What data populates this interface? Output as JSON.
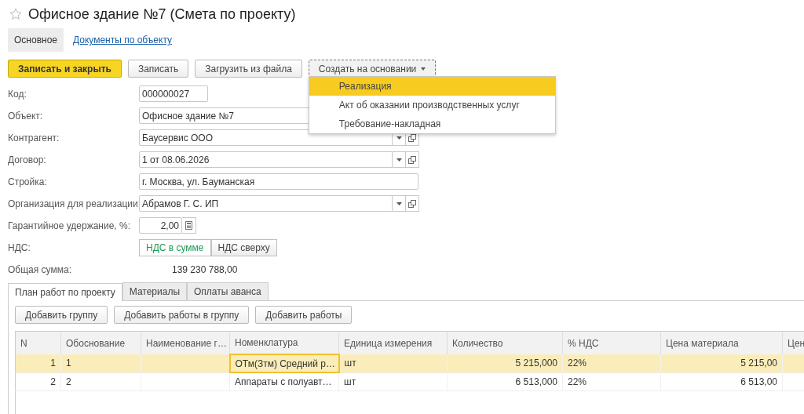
{
  "title": "Офисное здание №7 (Смета по проекту)",
  "favorite": false,
  "sections": [
    {
      "label": "Основное",
      "selected": true
    },
    {
      "label": "Документы по объекту",
      "selected": false
    }
  ],
  "toolbar": [
    {
      "label": "Записать и закрыть",
      "kind": "primary"
    },
    {
      "label": "Записать",
      "kind": "plain"
    },
    {
      "label": "Загрузить из файла",
      "kind": "plain"
    },
    {
      "label": "Создать на основании",
      "kind": "menu"
    }
  ],
  "menu": [
    {
      "label": "Реализация",
      "selected": true
    },
    {
      "label": "Акт об оказании производственных услуг",
      "selected": false
    },
    {
      "label": "Требование-накладная",
      "selected": false
    }
  ],
  "fields": [
    {
      "label": "Код:",
      "value": "000000027",
      "kind": "short"
    },
    {
      "label": "Объект:",
      "value": "Офисное здание №7",
      "kind": "text"
    },
    {
      "label": "Контрагент:",
      "value": "Баусервис ООО",
      "kind": "select"
    },
    {
      "label": "Договор:",
      "value": "1 от 08.06.2026",
      "kind": "select"
    },
    {
      "label": "Стройка:",
      "value": "г. Москва, ул. Бауманская",
      "kind": "text"
    },
    {
      "label": "Организация для реализации:",
      "value": "Абрамов Г. С. ИП",
      "kind": "select"
    },
    {
      "label": "Гарантийное удержание, %:",
      "value": "2,00",
      "kind": "number"
    },
    {
      "label": "НДС:",
      "kind": "toggle",
      "options": [
        {
          "label": "НДС в сумме",
          "selected": true
        },
        {
          "label": "НДС сверху",
          "selected": false
        }
      ]
    },
    {
      "label": "Общая сумма:",
      "value": "139 230 788,00",
      "kind": "sum"
    }
  ],
  "tabs": [
    {
      "label": "План работ по проекту",
      "selected": true
    },
    {
      "label": "Материалы",
      "selected": false
    },
    {
      "label": "Оплаты аванса",
      "selected": false
    }
  ],
  "table_buttons": [
    "Добавить группу",
    "Добавить работы в группу",
    "Добавить работы"
  ],
  "table": {
    "columns": [
      {
        "label": "N",
        "kind": "num"
      },
      {
        "label": "Обоснование",
        "kind": "text"
      },
      {
        "label": "Наименование г…",
        "kind": "text"
      },
      {
        "label": "Номенклатура",
        "kind": "text"
      },
      {
        "label": "Единица измерения",
        "kind": "text"
      },
      {
        "label": "Количество",
        "kind": "num"
      },
      {
        "label": "% НДС",
        "kind": "text"
      },
      {
        "label": "Цена материала",
        "kind": "num"
      },
      {
        "label": "Цен",
        "kind": "text"
      }
    ],
    "rows": [
      {
        "selected": true,
        "cells": [
          {
            "text": "1",
            "focused": false
          },
          {
            "text": "1",
            "focused": false
          },
          {
            "text": "",
            "focused": false
          },
          {
            "text": "ОТм(Зтм) Средний р…",
            "focused": true
          },
          {
            "text": "шт",
            "focused": false
          },
          {
            "text": "5 215,000",
            "focused": false
          },
          {
            "text": "22%",
            "focused": false
          },
          {
            "text": "5 215,00",
            "focused": false
          },
          {
            "text": "",
            "focused": false
          }
        ]
      },
      {
        "selected": false,
        "cells": [
          {
            "text": "2",
            "focused": false
          },
          {
            "text": "2",
            "focused": false
          },
          {
            "text": "",
            "focused": false
          },
          {
            "text": "Аппараты с полуавт…",
            "focused": false
          },
          {
            "text": "шт",
            "focused": false
          },
          {
            "text": "6 513,000",
            "focused": false
          },
          {
            "text": "22%",
            "focused": false
          },
          {
            "text": "6 513,00",
            "focused": false
          },
          {
            "text": "",
            "focused": false
          }
        ]
      }
    ]
  }
}
